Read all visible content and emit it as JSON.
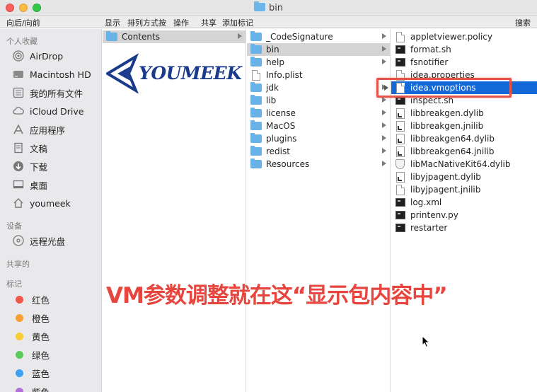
{
  "window": {
    "title": "bin"
  },
  "toolbar": {
    "back_forward": "向后/向前",
    "view": "显示",
    "arrange": "排列方式按",
    "action": "操作",
    "share": "共享",
    "add_tag": "添加标记",
    "search": "搜索"
  },
  "sidebar": {
    "favorites_header": "个人收藏",
    "favorites": [
      {
        "label": "AirDrop",
        "icon": "airdrop-icon"
      },
      {
        "label": "Macintosh HD",
        "icon": "hard-drive-icon"
      },
      {
        "label": "我的所有文件",
        "icon": "all-files-icon"
      },
      {
        "label": "iCloud Drive",
        "icon": "cloud-icon"
      },
      {
        "label": "应用程序",
        "icon": "applications-icon"
      },
      {
        "label": "文稿",
        "icon": "documents-icon"
      },
      {
        "label": "下载",
        "icon": "download-icon"
      },
      {
        "label": "桌面",
        "icon": "desktop-icon"
      },
      {
        "label": "youmeek",
        "icon": "home-icon"
      }
    ],
    "devices_header": "设备",
    "devices": [
      {
        "label": "远程光盘",
        "icon": "remote-disc-icon"
      }
    ],
    "shared_header": "共享的",
    "tags_header": "标记",
    "tags": [
      {
        "label": "红色",
        "color": "#f0574d"
      },
      {
        "label": "橙色",
        "color": "#f7a033"
      },
      {
        "label": "黄色",
        "color": "#f7cd35"
      },
      {
        "label": "绿色",
        "color": "#5bc95b"
      },
      {
        "label": "蓝色",
        "color": "#3fa0f0"
      },
      {
        "label": "紫色",
        "color": "#b26ed8"
      }
    ]
  },
  "columns": {
    "col1": [
      {
        "name": "Contents",
        "type": "folder",
        "has_children": true,
        "selected": "gray"
      }
    ],
    "col2": [
      {
        "name": "_CodeSignature",
        "type": "folder",
        "has_children": true
      },
      {
        "name": "bin",
        "type": "folder",
        "has_children": true,
        "selected": "gray"
      },
      {
        "name": "help",
        "type": "folder",
        "has_children": true
      },
      {
        "name": "Info.plist",
        "type": "doc",
        "has_children": false
      },
      {
        "name": "jdk",
        "type": "folder",
        "has_children": true
      },
      {
        "name": "lib",
        "type": "folder",
        "has_children": true
      },
      {
        "name": "license",
        "type": "folder",
        "has_children": true
      },
      {
        "name": "MacOS",
        "type": "folder",
        "has_children": true
      },
      {
        "name": "plugins",
        "type": "folder",
        "has_children": true
      },
      {
        "name": "redist",
        "type": "folder",
        "has_children": true
      },
      {
        "name": "Resources",
        "type": "folder",
        "has_children": true
      }
    ],
    "col3": [
      {
        "name": "appletviewer.policy",
        "type": "doc"
      },
      {
        "name": "format.sh",
        "type": "term"
      },
      {
        "name": "fsnotifier",
        "type": "term"
      },
      {
        "name": "idea.properties",
        "type": "doc"
      },
      {
        "name": "idea.vmoptions",
        "type": "doc",
        "selected": "blue",
        "has_children": true
      },
      {
        "name": "inspect.sh",
        "type": "term"
      },
      {
        "name": "libbreakgen.dylib",
        "type": "lib"
      },
      {
        "name": "libbreakgen.jnilib",
        "type": "lib"
      },
      {
        "name": "libbreakgen64.dylib",
        "type": "lib"
      },
      {
        "name": "libbreakgen64.jnilib",
        "type": "lib"
      },
      {
        "name": "libMacNativeKit64.dylib",
        "type": "shield"
      },
      {
        "name": "libyjpagent.dylib",
        "type": "lib"
      },
      {
        "name": "libyjpagent.jnilib",
        "type": "doc"
      },
      {
        "name": "log.xml",
        "type": "term"
      },
      {
        "name": "printenv.py",
        "type": "term"
      },
      {
        "name": "restarter",
        "type": "term"
      }
    ]
  },
  "logo": {
    "text": "YOUMEEK",
    "color": "#1a3a8c"
  },
  "annotation": {
    "text": "VM参数调整就在这“显示包内容中”",
    "color": "#e6463e"
  },
  "colors": {
    "selection_blue": "#1469d8",
    "highlight_red": "#e4524a",
    "folder_blue": "#68b2e8"
  }
}
